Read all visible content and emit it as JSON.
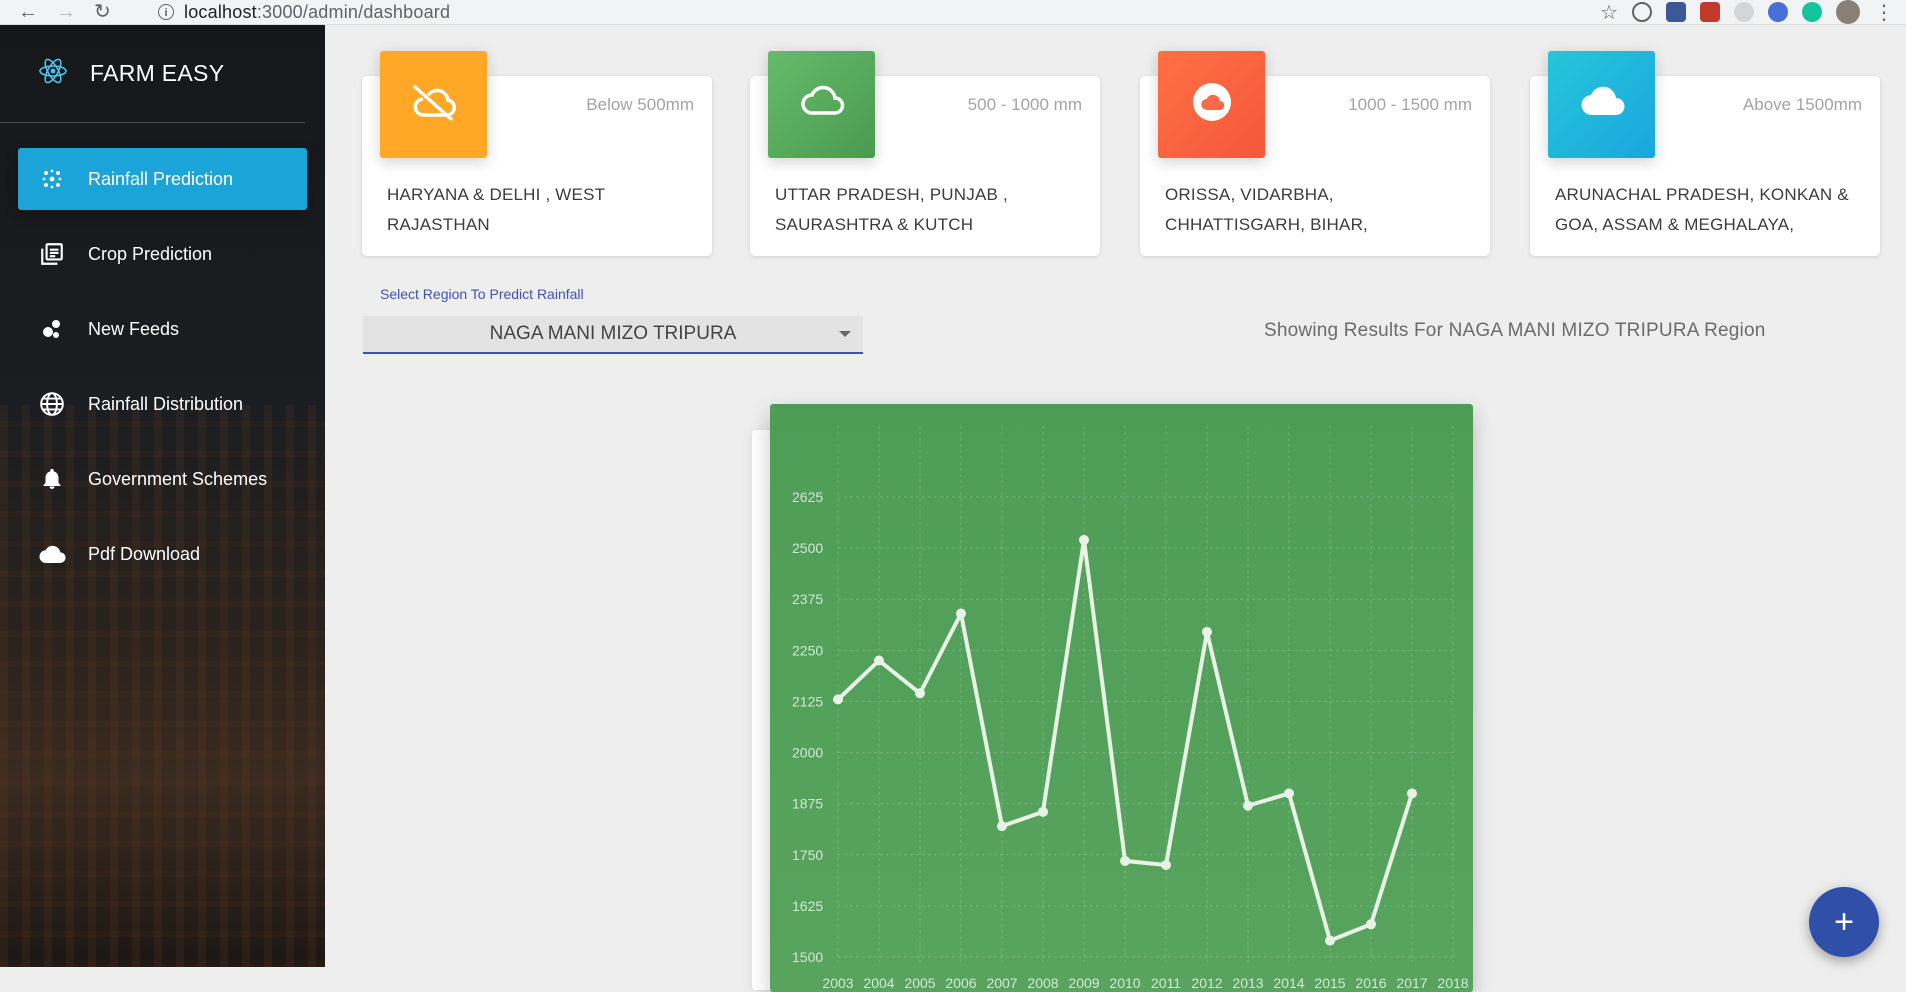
{
  "browser": {
    "url_host": "localhost",
    "url_path": ":3000/admin/dashboard"
  },
  "sidebar": {
    "brand": "FARM EASY",
    "items": [
      {
        "label": "Rainfall Prediction",
        "icon": "scatter-dots-icon",
        "active": true
      },
      {
        "label": "Crop Prediction",
        "icon": "library-books-icon",
        "active": false
      },
      {
        "label": "New Feeds",
        "icon": "bubble-chart-icon",
        "active": false
      },
      {
        "label": "Rainfall Distribution",
        "icon": "globe-icon",
        "active": false
      },
      {
        "label": "Government Schemes",
        "icon": "bell-icon",
        "active": false
      },
      {
        "label": "Pdf Download",
        "icon": "cloud-icon",
        "active": false
      }
    ]
  },
  "cards": [
    {
      "range": "Below 500mm",
      "regions": "HARYANA & DELHI , WEST RAJASTHAN",
      "color": "#ffa726",
      "icon": "cloud-off-icon"
    },
    {
      "range": "500 - 1000 mm",
      "regions": "UTTAR PRADESH, PUNJAB , SAURASHTRA & KUTCH",
      "color": "#5ca862",
      "icon": "cloud-outline-icon"
    },
    {
      "range": "1000 - 1500 mm",
      "regions": "ORISSA, VIDARBHA, CHHATTISGARH, BIHAR,",
      "color": "#f96a4b",
      "icon": "cloud-circle-icon"
    },
    {
      "range": "Above 1500mm",
      "regions": "ARUNACHAL PRADESH, KONKAN & GOA, ASSAM & MEGHALAYA,",
      "color": "#1daee0",
      "icon": "cloud-filled-icon"
    }
  ],
  "region_select": {
    "label": "Select Region To Predict Rainfall",
    "value": "NAGA MANI MIZO TRIPURA"
  },
  "results_text": "Showing Results For NAGA MANI MIZO TRIPURA Region",
  "fab_label": "+",
  "chart_data": {
    "type": "line",
    "x": [
      2003,
      2004,
      2005,
      2006,
      2007,
      2008,
      2009,
      2010,
      2011,
      2012,
      2013,
      2014,
      2015,
      2016
    ],
    "x_ticks": [
      "2003",
      "2004",
      "2005",
      "2006",
      "2007",
      "2008",
      "2009",
      "2010",
      "2011",
      "2012",
      "2013",
      "2014",
      "2015",
      "2016",
      "2017",
      "2018"
    ],
    "y_ticks": [
      "2625",
      "2500",
      "2375",
      "2250",
      "2125",
      "2000",
      "1875",
      "1750",
      "1625",
      "1500"
    ],
    "series": [
      {
        "values": [
          2130,
          2225,
          2145,
          2340,
          1820,
          1855,
          2520,
          1735,
          1725,
          2295,
          1870,
          1900,
          1540,
          1580,
          1900
        ]
      }
    ],
    "points_x": [
      2003,
      2004,
      2005,
      2006,
      2007,
      2008,
      2009,
      2010,
      2011,
      2012,
      2013,
      2014,
      2015,
      2016,
      2017
    ],
    "ylim": [
      1500,
      2625
    ],
    "xlim": [
      2003,
      2018
    ],
    "grid": true,
    "line_color": "#e9f2e6",
    "background": "#55a25c"
  }
}
